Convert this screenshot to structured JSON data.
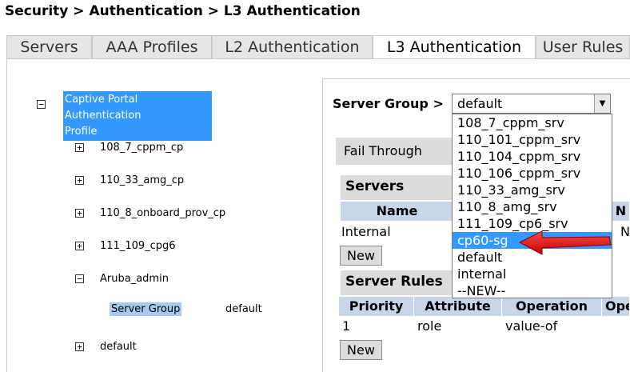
{
  "breadcrumb": "Security > Authentication > L3 Authentication",
  "tabs": [
    {
      "label": "Servers"
    },
    {
      "label": "AAA Profiles"
    },
    {
      "label": "L2 Authentication"
    },
    {
      "label": "L3 Authentication",
      "active": true
    },
    {
      "label": "User Rules"
    }
  ],
  "tree": {
    "root_label_line1": "Captive Portal Authentication",
    "root_label_line2": "Profile",
    "expand_glyph": "+",
    "collapse_glyph": "−",
    "items": [
      {
        "label": "108_7_cppm_cp",
        "expanded": false
      },
      {
        "label": "110_33_amg_cp",
        "expanded": false
      },
      {
        "label": "110_8_onboard_prov_cp",
        "expanded": false
      },
      {
        "label": "111_109_cpg6",
        "expanded": false
      },
      {
        "label": "Aruba_admin",
        "expanded": true
      },
      {
        "label": "default",
        "expanded": false
      }
    ],
    "aruba_admin_child": {
      "label": "Server Group",
      "value": "default"
    }
  },
  "server_group": {
    "label": "Server Group >",
    "selected": "default",
    "arrow_icon": "▼",
    "options": [
      "108_7_cppm_srv",
      "110_101_cppm_srv",
      "110_104_cppm_srv",
      "110_106_cppm_srv",
      "110_33_amg_srv",
      "110_8_amg_srv",
      "111_109_cp6_srv",
      "cp60-sg",
      "default",
      "internal",
      "--NEW--"
    ],
    "highlighted_option": "cp60-sg"
  },
  "fail_through": {
    "label": "Fail Through"
  },
  "servers_section": {
    "title": "Servers",
    "columns": [
      "Name",
      "",
      "N"
    ],
    "rows": [
      {
        "name": "Internal",
        "trailing": "N"
      }
    ],
    "new_button": "New"
  },
  "server_rules_section": {
    "title": "Server Rules",
    "columns": [
      "Priority",
      "Attribute",
      "Operation",
      "Ope"
    ],
    "rows": [
      {
        "priority": "1",
        "attribute": "role",
        "operation": "value-of"
      }
    ],
    "new_button": "New"
  },
  "annotation": {
    "color": "#e01010",
    "meaning": "arrow pointing at cp60-sg"
  }
}
